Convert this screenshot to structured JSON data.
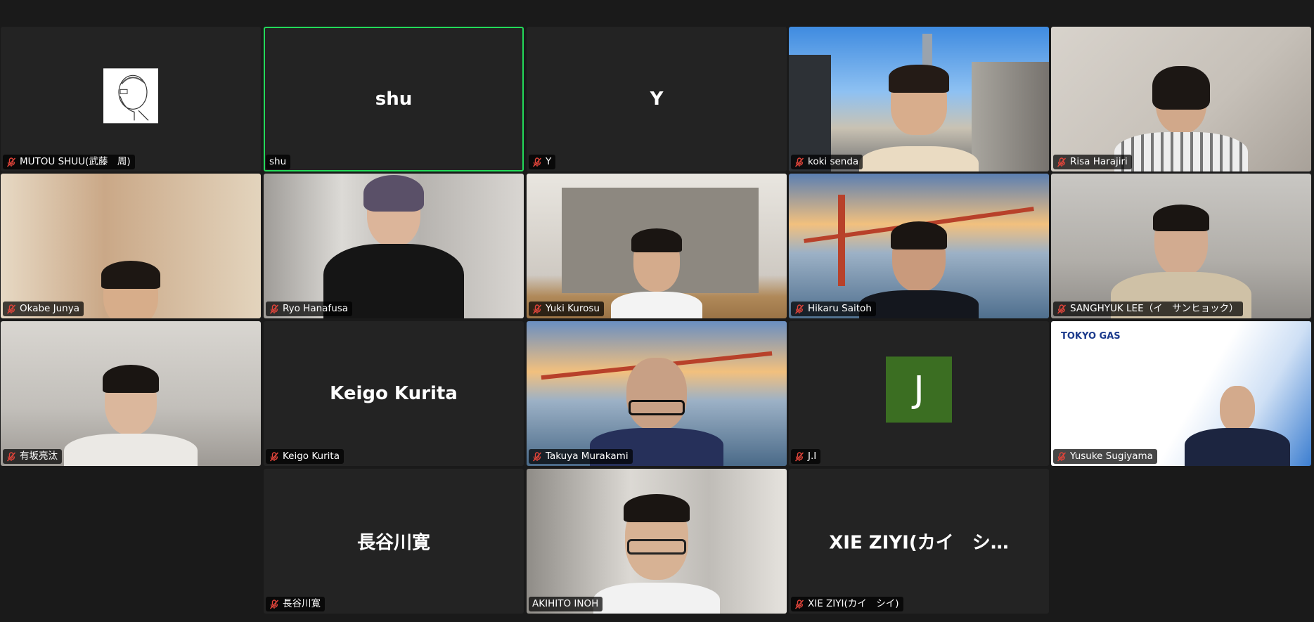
{
  "colors": {
    "speaking_border": "#23d959",
    "avatar_bg": "#3b6e22",
    "mute": "#e0443a"
  },
  "participants": [
    {
      "label": "MUTOU SHUU(武藤　周)",
      "display": "",
      "muted": true,
      "type": "sketch"
    },
    {
      "label": "shu",
      "display": "shu",
      "muted": false,
      "type": "name",
      "speaking": true
    },
    {
      "label": "Y",
      "display": "Y",
      "muted": true,
      "type": "name"
    },
    {
      "label": "koki senda",
      "muted": true,
      "type": "video"
    },
    {
      "label": "Risa Harajiri",
      "muted": true,
      "type": "video"
    },
    {
      "label": "Okabe Junya",
      "muted": true,
      "type": "video"
    },
    {
      "label": "Ryo Hanafusa",
      "muted": true,
      "type": "video"
    },
    {
      "label": "Yuki Kurosu",
      "muted": true,
      "type": "video"
    },
    {
      "label": "Hikaru Saitoh",
      "muted": true,
      "type": "video"
    },
    {
      "label": "SANGHYUK LEE（イ　サンヒョック）",
      "muted": true,
      "type": "video"
    },
    {
      "label": "有坂亮汰",
      "muted": true,
      "type": "video"
    },
    {
      "label": "Keigo Kurita",
      "display": "Keigo Kurita",
      "muted": true,
      "type": "name"
    },
    {
      "label": "Takuya Murakami",
      "muted": true,
      "type": "video"
    },
    {
      "label": "J.I",
      "avatar": "J",
      "muted": true,
      "type": "avatar"
    },
    {
      "label": "Yusuke Sugiyama",
      "muted": true,
      "type": "video",
      "logo": "TOKYO GAS"
    },
    {
      "label": "長谷川寛",
      "display": "長谷川寛",
      "muted": true,
      "type": "name"
    },
    {
      "label": "AKIHITO INOH",
      "muted": false,
      "type": "video"
    },
    {
      "label": "XIE ZIYI(カイ　シイ)",
      "display": "XIE ZIYI(カイ　シ…",
      "muted": true,
      "type": "name"
    }
  ]
}
